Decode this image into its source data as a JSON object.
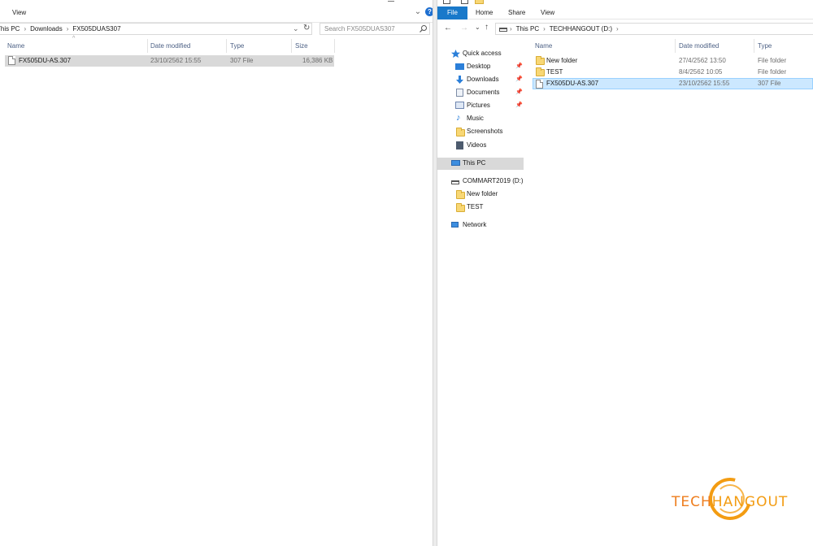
{
  "left_window": {
    "ribbon": {
      "view_tab": "View"
    },
    "address": {
      "crumbs": [
        "This PC",
        "Downloads",
        "FX505DUAS307"
      ]
    },
    "search_placeholder": "Search FX505DUAS307",
    "columns": {
      "name": "Name",
      "date": "Date modified",
      "type": "Type",
      "size": "Size"
    },
    "files": [
      {
        "name": "FX505DU-AS.307",
        "date": "23/10/2562 15:55",
        "type": "307 File",
        "size": "16,386 KB"
      }
    ]
  },
  "right_window": {
    "ribbon": {
      "file_tab": "File",
      "home_tab": "Home",
      "share_tab": "Share",
      "view_tab": "View"
    },
    "address": {
      "crumbs": [
        "This PC",
        "TECHHANGOUT (D:)"
      ]
    },
    "columns": {
      "name": "Name",
      "date": "Date modified",
      "type": "Type"
    },
    "files": [
      {
        "name": "New folder",
        "date": "27/4/2562 13:50",
        "type": "File folder",
        "kind": "folder"
      },
      {
        "name": "TEST",
        "date": "8/4/2562 10:05",
        "type": "File folder",
        "kind": "folder"
      },
      {
        "name": "FX505DU-AS.307",
        "date": "23/10/2562 15:55",
        "type": "307 File",
        "kind": "file"
      }
    ],
    "nav": {
      "quick_access": "Quick access",
      "desktop": "Desktop",
      "downloads": "Downloads",
      "documents": "Documents",
      "pictures": "Pictures",
      "music": "Music",
      "screenshots": "Screenshots",
      "videos": "Videos",
      "this_pc": "This PC",
      "drive": "COMMART2019 (D:)",
      "drive_new_folder": "New folder",
      "drive_test": "TEST",
      "network": "Network"
    }
  },
  "watermark": {
    "part1": "TECH",
    "part2": "HANGOUT"
  },
  "colors": {
    "accent": "#1979ca",
    "selection_blue": "#cce8ff",
    "selection_gray": "#d9d9d9",
    "folder": "#f8d775",
    "brand_orange": "#f39c12"
  }
}
